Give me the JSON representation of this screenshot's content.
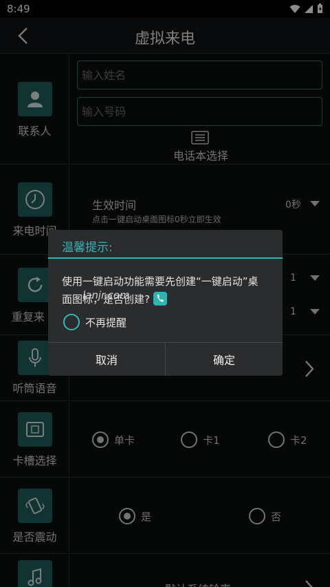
{
  "status_bar": {
    "time": "8:49"
  },
  "toolbar": {
    "title": "虚拟来电",
    "back_icon": "back-arrow-icon"
  },
  "contact": {
    "label": "联系人",
    "name_placeholder": "输入姓名",
    "number_placeholder": "输入号码",
    "phonebook_label": "电话本选择"
  },
  "call_time": {
    "label": "来电时间",
    "field_label": "生效时间",
    "value": "0秒",
    "hint": "点击一键启动桌面图标0秒立即生效"
  },
  "repeat": {
    "label": "重复来",
    "value1": "1",
    "value2": "1"
  },
  "earpiece": {
    "label": "听筒语音"
  },
  "sim_slot": {
    "label": "卡槽选择",
    "options": [
      "单卡",
      "卡1",
      "卡2"
    ],
    "selected": "单卡"
  },
  "vibrate": {
    "label": "是否震动",
    "options": [
      "是",
      "否"
    ],
    "selected": "是"
  },
  "ringtone": {
    "value": "默认系统铃声"
  },
  "dialog": {
    "title": "温馨提示:",
    "message": "使用一键启动功能需要先创建“一键启动”桌面图标，是否创建?",
    "checkbox_label": "不再提醒",
    "cancel_label": "取消",
    "confirm_label": "确定"
  },
  "watermark": "lanjr.com",
  "colors": {
    "accent": "#33b6b6",
    "tile": "#1f5d5b",
    "background": "#0c0d0e",
    "dialog": "#2b2c2e"
  }
}
